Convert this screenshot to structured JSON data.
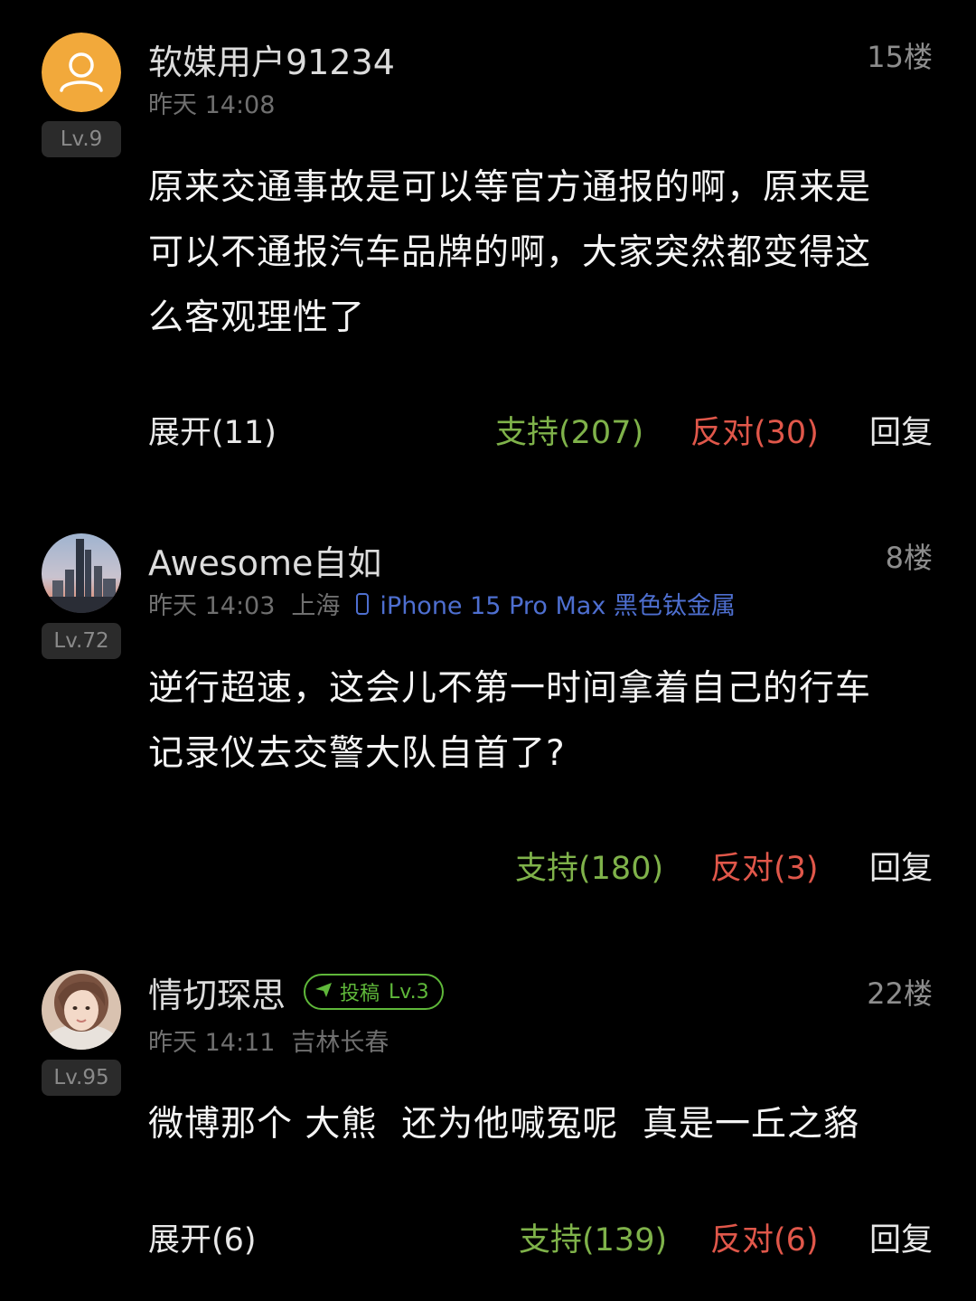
{
  "comments": [
    {
      "username": "软媒用户91234",
      "floor": "15楼",
      "level": "Lv.9",
      "time": "昨天 14:08",
      "avatar": "default-user-icon",
      "avatar_color": "#f2a93b",
      "text": "原来交通事故是可以等官方通报的啊，原来是\n可以不通报汽车品牌的啊，大家突然都变得这\n么客观理性了",
      "expand": "展开(11)",
      "support": "支持(207)",
      "oppose": "反对(30)",
      "reply": "回复"
    },
    {
      "username": "Awesome自如",
      "floor": "8楼",
      "level": "Lv.72",
      "time": "昨天 14:03",
      "location": "上海",
      "device": "iPhone 15 Pro Max 黑色钛金属",
      "avatar": "city-skyline-photo",
      "text": "逆行超速，这会儿不第一时间拿着自己的行车\n记录仪去交警大队自首了?",
      "support": "支持(180)",
      "oppose": "反对(3)",
      "reply": "回复"
    },
    {
      "username": "情切琛思",
      "badge_label": "投稿",
      "badge_level": "Lv.3",
      "floor": "22楼",
      "level": "Lv.95",
      "time": "昨天 14:11",
      "location": "吉林长春",
      "avatar": "portrait-photo",
      "text": "微博那个 大熊  还为他喊冤呢  真是一丘之貉",
      "expand": "展开(6)",
      "support": "支持(139)",
      "oppose": "反对(6)",
      "reply": "回复"
    }
  ],
  "colors": {
    "background": "#000000",
    "support": "#7fb24a",
    "oppose": "#e0574a",
    "device": "#4e6fd0",
    "badge": "#5fb83a"
  }
}
